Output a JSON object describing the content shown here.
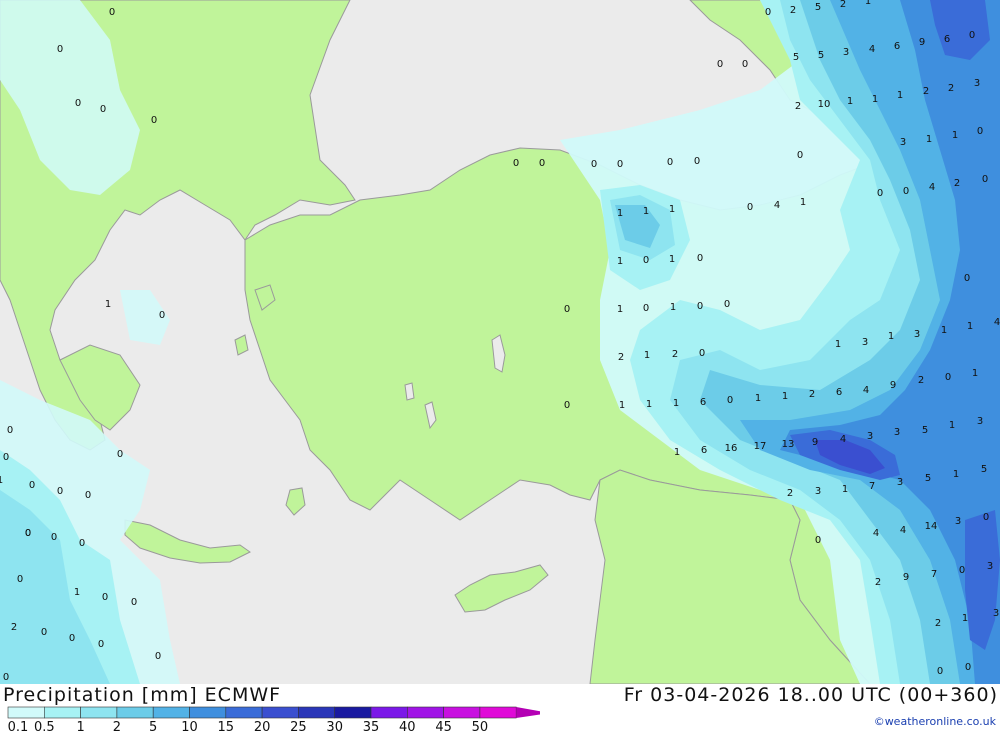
{
  "map": {
    "region": "Eastern Mediterranean, Turkey and Black Sea",
    "colors": {
      "sea": "#ebebeb",
      "land": "#c0f49a",
      "border": "#9a9a9a",
      "precip_0_1": "#d1fafa",
      "precip_0_5": "#a7f2f4",
      "precip_1": "#8ee4f0",
      "precip_2": "#6ccce8",
      "precip_5": "#52b2e6",
      "precip_10": "#3f8fde",
      "precip_15": "#3a6cd8",
      "precip_20": "#3a4fd0"
    },
    "labels": [
      {
        "v": "0"
      },
      {
        "v": "2"
      },
      {
        "v": "5"
      },
      {
        "v": "2"
      },
      {
        "v": "1"
      },
      {
        "v": "0"
      },
      {
        "v": "0"
      },
      {
        "v": "0"
      },
      {
        "v": "5"
      },
      {
        "v": "5"
      },
      {
        "v": "3"
      },
      {
        "v": "4"
      },
      {
        "v": "6"
      },
      {
        "v": "9"
      },
      {
        "v": "6"
      },
      {
        "v": "0"
      },
      {
        "v": "2"
      },
      {
        "v": "10"
      },
      {
        "v": "1"
      },
      {
        "v": "1"
      },
      {
        "v": "1"
      },
      {
        "v": "2"
      },
      {
        "v": "2"
      },
      {
        "v": "3"
      },
      {
        "v": "3"
      },
      {
        "v": "1"
      },
      {
        "v": "1"
      },
      {
        "v": "0"
      },
      {
        "v": "0"
      },
      {
        "v": "0"
      },
      {
        "v": "4"
      },
      {
        "v": "2"
      },
      {
        "v": "0"
      },
      {
        "v": "0"
      },
      {
        "v": "0"
      },
      {
        "v": "0"
      },
      {
        "v": "0"
      },
      {
        "v": "0"
      },
      {
        "v": "0"
      },
      {
        "v": "0"
      },
      {
        "v": "0"
      },
      {
        "v": "4"
      },
      {
        "v": "1"
      },
      {
        "v": "1"
      },
      {
        "v": "1"
      },
      {
        "v": "1"
      },
      {
        "v": "0"
      },
      {
        "v": "1"
      },
      {
        "v": "0"
      },
      {
        "v": "0"
      },
      {
        "v": "1"
      },
      {
        "v": "0"
      },
      {
        "v": "1"
      },
      {
        "v": "0"
      },
      {
        "v": "0"
      },
      {
        "v": "1"
      },
      {
        "v": "1"
      },
      {
        "v": "3"
      },
      {
        "v": "1"
      },
      {
        "v": "3"
      },
      {
        "v": "1"
      },
      {
        "v": "1"
      },
      {
        "v": "4"
      },
      {
        "v": "0"
      },
      {
        "v": "2"
      },
      {
        "v": "1"
      },
      {
        "v": "2"
      },
      {
        "v": "0"
      },
      {
        "v": "0"
      },
      {
        "v": "1"
      },
      {
        "v": "1"
      },
      {
        "v": "1"
      },
      {
        "v": "6"
      },
      {
        "v": "0"
      },
      {
        "v": "1"
      },
      {
        "v": "1"
      },
      {
        "v": "2"
      },
      {
        "v": "6"
      },
      {
        "v": "4"
      },
      {
        "v": "9"
      },
      {
        "v": "2"
      },
      {
        "v": "0"
      },
      {
        "v": "1"
      },
      {
        "v": "1"
      },
      {
        "v": "6"
      },
      {
        "v": "16"
      },
      {
        "v": "17"
      },
      {
        "v": "13"
      },
      {
        "v": "9"
      },
      {
        "v": "4"
      },
      {
        "v": "3"
      },
      {
        "v": "3"
      },
      {
        "v": "5"
      },
      {
        "v": "1"
      },
      {
        "v": "3"
      },
      {
        "v": "2"
      },
      {
        "v": "3"
      },
      {
        "v": "1"
      },
      {
        "v": "7"
      },
      {
        "v": "3"
      },
      {
        "v": "5"
      },
      {
        "v": "1"
      },
      {
        "v": "5"
      },
      {
        "v": "4"
      },
      {
        "v": "4"
      },
      {
        "v": "14"
      },
      {
        "v": "3"
      },
      {
        "v": "0"
      },
      {
        "v": "0"
      },
      {
        "v": "2"
      },
      {
        "v": "9"
      },
      {
        "v": "7"
      },
      {
        "v": "0"
      },
      {
        "v": "3"
      },
      {
        "v": "2"
      },
      {
        "v": "1"
      },
      {
        "v": "3"
      },
      {
        "v": "0"
      },
      {
        "v": "0"
      },
      {
        "v": "0"
      },
      {
        "v": "0"
      },
      {
        "v": "0"
      },
      {
        "v": "0"
      },
      {
        "v": "0"
      },
      {
        "v": "0"
      },
      {
        "v": "0"
      },
      {
        "v": "0"
      },
      {
        "v": "1"
      },
      {
        "v": "0"
      },
      {
        "v": "0"
      },
      {
        "v": "2"
      },
      {
        "v": "0"
      },
      {
        "v": "0"
      },
      {
        "v": "0"
      },
      {
        "v": "0"
      },
      {
        "v": "0"
      },
      {
        "v": "0"
      },
      {
        "v": "0"
      },
      {
        "v": "0"
      },
      {
        "v": "0"
      },
      {
        "v": "1"
      },
      {
        "v": "0"
      },
      {
        "v": "0"
      },
      {
        "v": "1"
      },
      {
        "v": "0"
      },
      {
        "v": "0"
      }
    ]
  },
  "footer": {
    "title": "Precipitation [mm] ECMWF",
    "datetime": "Fr 03-04-2026 18..00 UTC (00+360)",
    "credit": "©weatheronline.co.uk",
    "legend": {
      "ticks": [
        "0.1",
        "0.5",
        "1",
        "2",
        "5",
        "10",
        "15",
        "20",
        "25",
        "30",
        "35",
        "40",
        "45",
        "50"
      ],
      "colors": [
        "#d1fafa",
        "#a7f2f4",
        "#8ee4f0",
        "#6ccce8",
        "#52b2e6",
        "#3f8fde",
        "#3a6cd8",
        "#3a4fd0",
        "#2a36b8",
        "#1a1aa0",
        "#7b18e8",
        "#a014e6",
        "#c810e0",
        "#e00ad8",
        "#b400b4"
      ]
    }
  }
}
